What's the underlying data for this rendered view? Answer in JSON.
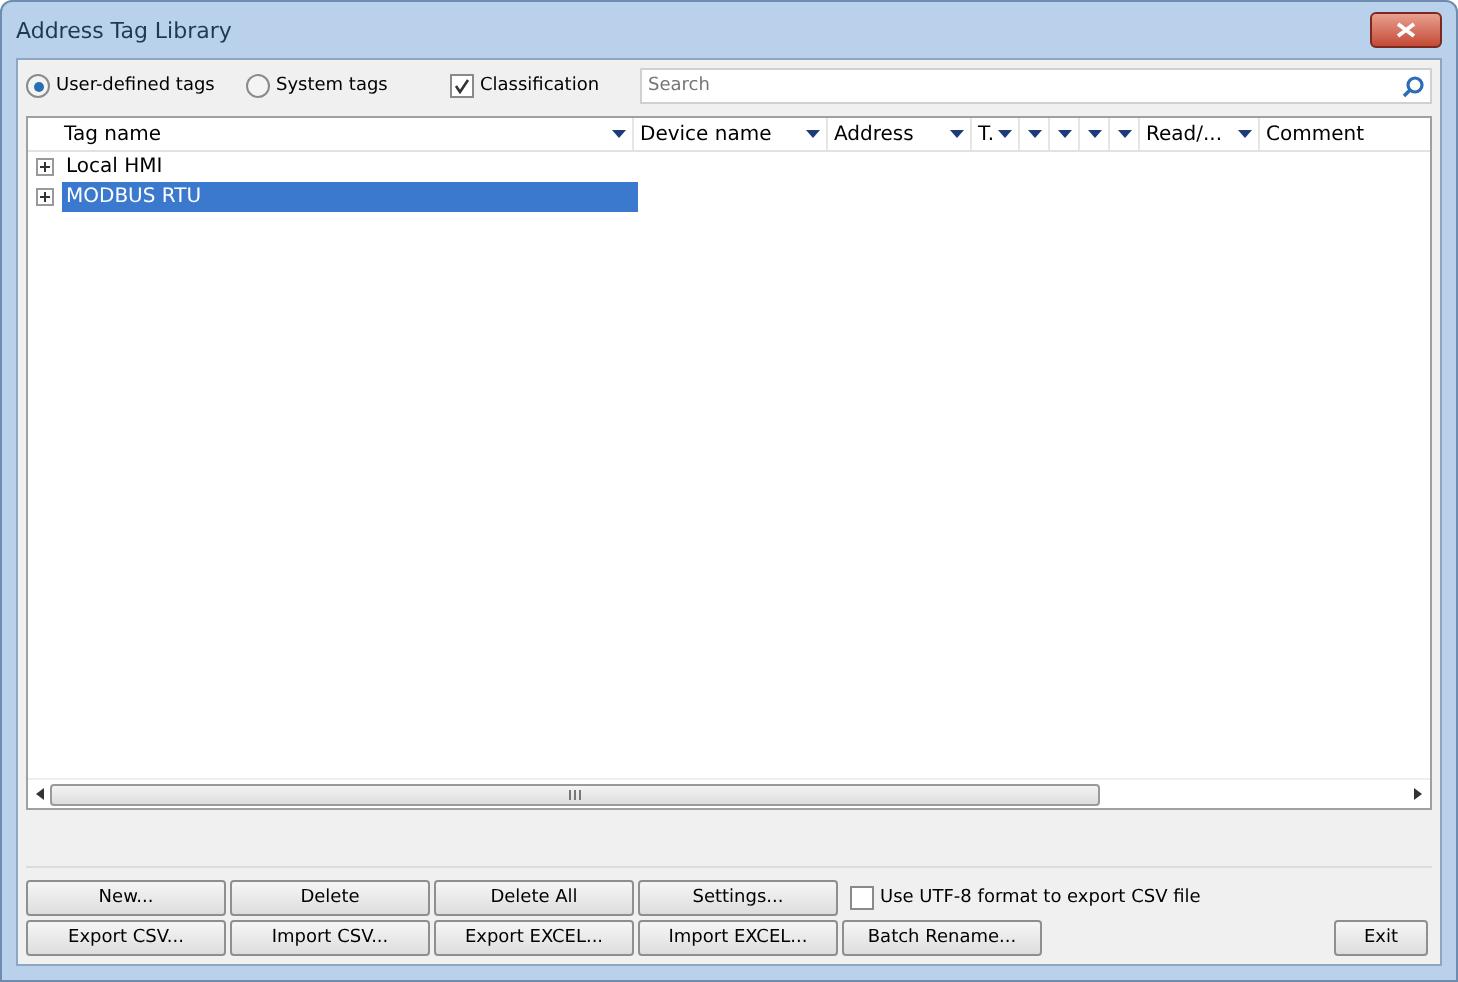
{
  "window": {
    "title": "Address Tag Library"
  },
  "filters": [
    {
      "kind": "radio",
      "label": "User-defined tags",
      "selected": true
    },
    {
      "kind": "radio",
      "label": "System tags",
      "selected": false
    },
    {
      "kind": "checkbox",
      "label": "Classification",
      "checked": true
    }
  ],
  "search": {
    "placeholder": "Search"
  },
  "table": {
    "columns": [
      {
        "kind": "text",
        "label": "Tag name"
      },
      {
        "kind": "text",
        "label": "Device name"
      },
      {
        "kind": "text",
        "label": "Address"
      },
      {
        "kind": "text",
        "label": "T."
      },
      {
        "kind": "blank"
      },
      {
        "kind": "blank"
      },
      {
        "kind": "blank"
      },
      {
        "kind": "blank"
      },
      {
        "kind": "text",
        "label": "Read/..."
      },
      {
        "kind": "plain",
        "label": "Comment"
      }
    ],
    "rows": [
      {
        "label": "Local HMI",
        "expanded": false,
        "selected": false
      },
      {
        "label": "MODBUS RTU",
        "expanded": false,
        "selected": true
      }
    ]
  },
  "buttons": [
    [
      "New...",
      "Delete",
      "Delete All",
      "Settings..."
    ],
    [
      "Export CSV...",
      "Import CSV...",
      "Export EXCEL...",
      "Import EXCEL...",
      "Batch Rename..."
    ]
  ],
  "utf8_option": {
    "label": "Use UTF-8 format to export CSV file",
    "checked": false
  },
  "exit_button": "Exit"
}
